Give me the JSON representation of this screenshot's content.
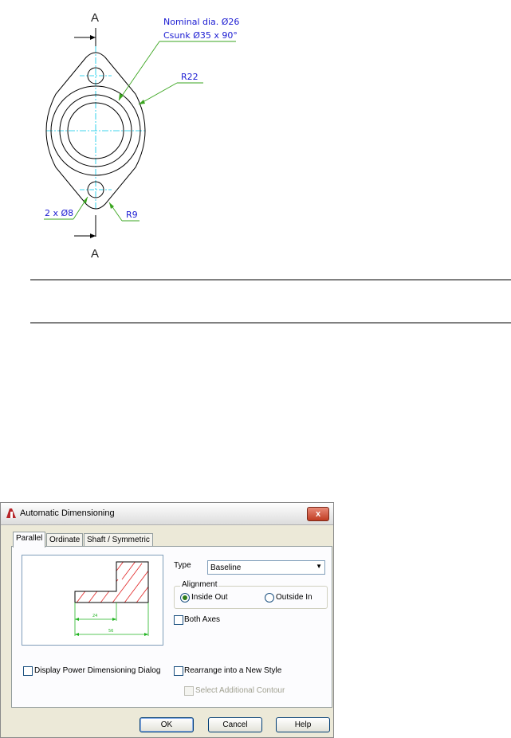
{
  "drawing": {
    "section_top": "A",
    "section_bottom": "A",
    "callout_nominal": "Nominal dia. Ø26",
    "callout_csunk": "Csunk Ø35 x 90°",
    "callout_r22": "R22",
    "callout_holes": "2 x Ø8",
    "callout_r9": "R9"
  },
  "dialog": {
    "title": "Automatic Dimensioning",
    "close_label": "x",
    "tabs": [
      {
        "label": "Parallel",
        "active": true
      },
      {
        "label": "Ordinate",
        "active": false
      },
      {
        "label": "Shaft / Symmetric",
        "active": false
      }
    ],
    "type_label": "Type",
    "type_value": "Baseline",
    "alignment_label": "Alignment",
    "radio_inside": "Inside Out",
    "radio_outside": "Outside In",
    "both_axes": "Both Axes",
    "display_power": "Display Power Dimensioning Dialog",
    "rearrange": "Rearrange into a New Style",
    "select_contour": "Select Additional Contour",
    "preview_dim_short": "24",
    "preview_dim_long": "56",
    "ok": "OK",
    "cancel": "Cancel",
    "help": "Help"
  }
}
